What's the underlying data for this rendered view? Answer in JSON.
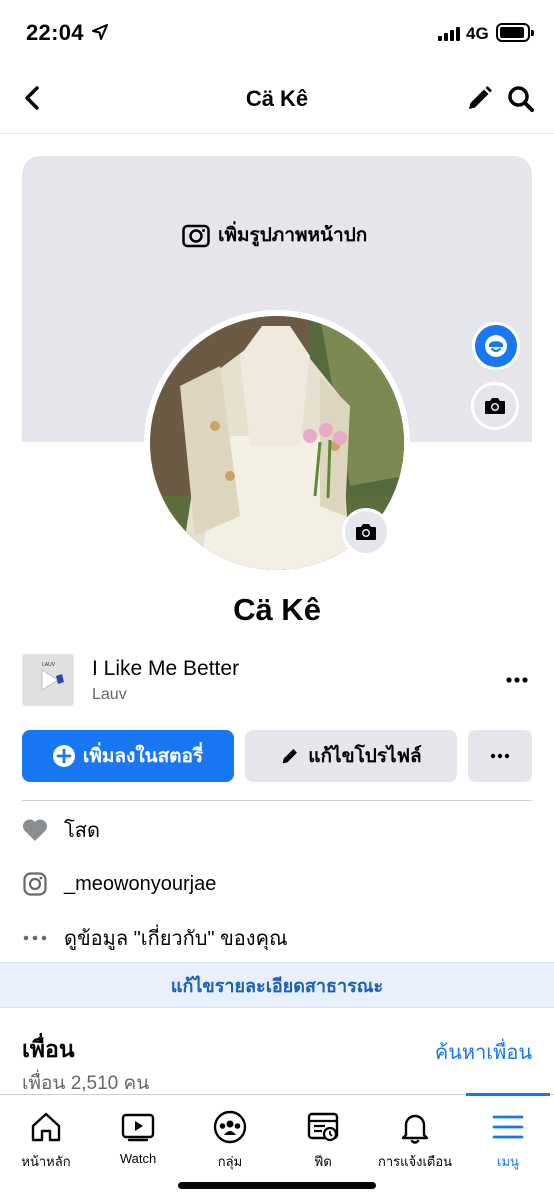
{
  "status_bar": {
    "time": "22:04",
    "network": "4G"
  },
  "header": {
    "title": "Cä Kê"
  },
  "cover": {
    "add_cover_label": "เพิ่มรูปภาพหน้าปก"
  },
  "profile": {
    "name": "Cä Kê"
  },
  "music": {
    "title": "I Like Me Better",
    "artist": "Lauv",
    "album_text": "LAUV"
  },
  "actions": {
    "add_story_label": "เพิ่มลงในสตอรี่",
    "edit_profile_label": "แก้ไขโปรไฟล์"
  },
  "details": {
    "relationship": "โสด",
    "instagram": "_meowonyourjae",
    "about": "ดูข้อมูล \"เกี่ยวกับ\" ของคุณ"
  },
  "edit_public_label": "แก้ไขรายละเอียดสาธารณะ",
  "friends": {
    "title": "เพื่อน",
    "count_text": "เพื่อน 2,510 คน",
    "find_label": "ค้นหาเพื่อน"
  },
  "tabs": [
    {
      "label": "หน้าหลัก",
      "icon": "home-icon"
    },
    {
      "label": "Watch",
      "icon": "watch-icon"
    },
    {
      "label": "กลุ่ม",
      "icon": "groups-icon"
    },
    {
      "label": "ฟีด",
      "icon": "feeds-icon"
    },
    {
      "label": "การแจ้งเตือน",
      "icon": "bell-icon"
    },
    {
      "label": "เมนู",
      "icon": "menu-icon",
      "active": true
    }
  ],
  "colors": {
    "accent": "#1877f2",
    "background": "#ffffff",
    "secondary_bg": "#e4e6eb",
    "muted_text": "#65676b"
  }
}
